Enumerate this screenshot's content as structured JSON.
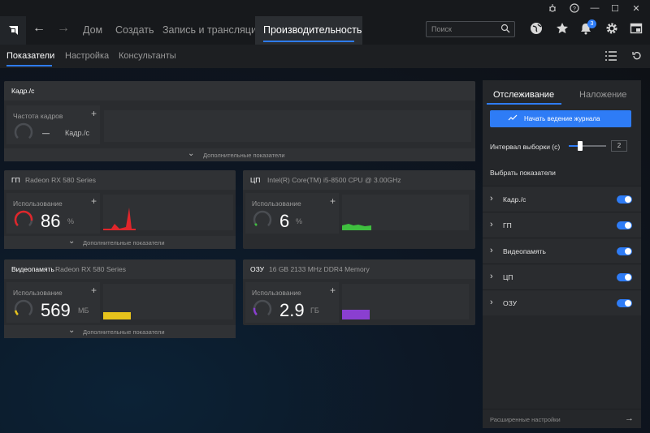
{
  "window": {
    "minimize": "—",
    "maximize": "☐",
    "close": "✕",
    "notification_count": "3"
  },
  "nav": {
    "home": "Дом",
    "create": "Создать",
    "record": "Запись и трансляция",
    "performance": "Производительность"
  },
  "search": {
    "placeholder": "Поиск"
  },
  "subtabs": {
    "metrics": "Показатели",
    "settings": "Настройка",
    "advisors": "Консультанты"
  },
  "fps_panel": {
    "title": "Кадр./с",
    "metric_label": "Частота кадров",
    "value": "—",
    "unit": "Кадр./с",
    "more": "Дополнительные показатели"
  },
  "gpu_panel": {
    "title": "ГП",
    "subtitle": "Radeon RX 580 Series",
    "metric_label": "Использование",
    "value": "86",
    "unit": "%",
    "more": "Дополнительные показатели"
  },
  "cpu_panel": {
    "title": "ЦП",
    "subtitle": "Intel(R) Core(TM) i5-8500 CPU @ 3.00GHz",
    "metric_label": "Использование",
    "value": "6",
    "unit": "%"
  },
  "vram_panel": {
    "title": "Видеопамять",
    "subtitle": "Radeon RX 580 Series",
    "metric_label": "Использование",
    "value": "569",
    "unit": "МБ",
    "more": "Дополнительные показатели"
  },
  "ram_panel": {
    "title": "ОЗУ",
    "subtitle": "16 GB 2133 MHz DDR4 Memory",
    "metric_label": "Использование",
    "value": "2.9",
    "unit": "ГБ"
  },
  "tracking": {
    "tab_tracking": "Отслеживание",
    "tab_overlay": "Наложение",
    "start_logging": "Начать ведение журнала",
    "interval_label": "Интервал выборки (с)",
    "interval_value": "2",
    "select_metrics": "Выбрать показатели",
    "rows": [
      {
        "label": "Кадр./с",
        "on": true
      },
      {
        "label": "ГП",
        "on": true
      },
      {
        "label": "Видеопамять",
        "on": true
      },
      {
        "label": "ЦП",
        "on": true
      },
      {
        "label": "ОЗУ",
        "on": true
      }
    ],
    "advanced": "Расширенные настройки"
  },
  "colors": {
    "accent": "#2e7cf6",
    "gpu": "#e0262b",
    "cpu": "#3fbf3f",
    "vram": "#e6c21c",
    "ram": "#8a3fd0"
  }
}
